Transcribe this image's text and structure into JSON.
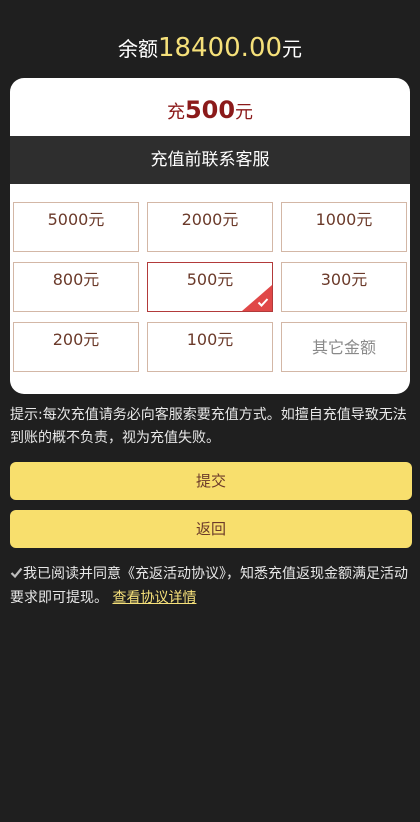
{
  "balance": {
    "prefix": "余额",
    "amount": "18400.00",
    "suffix": "元"
  },
  "card": {
    "header_prefix": "充",
    "header_amount": "500",
    "header_suffix": "元",
    "contact_text": "充值前联系客服",
    "options": [
      {
        "label": "5000元",
        "selected": false
      },
      {
        "label": "2000元",
        "selected": false
      },
      {
        "label": "1000元",
        "selected": false
      },
      {
        "label": "800元",
        "selected": false
      },
      {
        "label": "500元",
        "selected": true
      },
      {
        "label": "300元",
        "selected": false
      },
      {
        "label": "200元",
        "selected": false
      },
      {
        "label": "100元",
        "selected": false
      },
      {
        "label": "其它金额",
        "selected": false
      }
    ]
  },
  "hint": "提示:每次充值请务必向客服索要充值方式。如擅自充值导致无法到账的概不负责，视为充值失败。",
  "buttons": {
    "submit": "提交",
    "back": "返回"
  },
  "agreement": {
    "text": "我已阅读并同意《充返活动协议》，知悉充值返现金额满足活动要求即可提现。",
    "link": "查看协议详情",
    "checked": true
  },
  "colors": {
    "background": "#1f1f1f",
    "accent_yellow": "#f8df6d",
    "amount_red": "#8b1a1a",
    "selected_red": "#e04848"
  }
}
